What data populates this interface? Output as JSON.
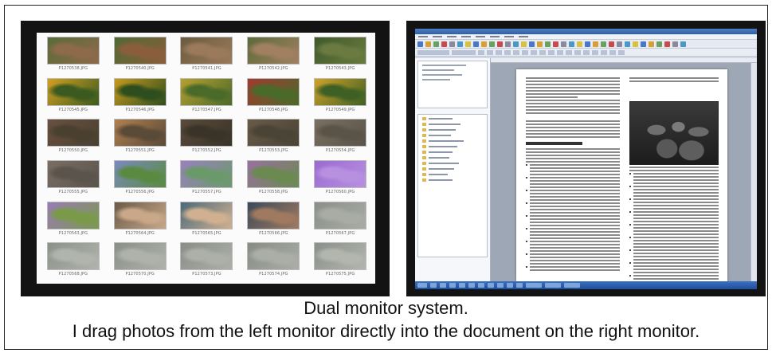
{
  "caption": {
    "line1": "Dual monitor system.",
    "line2": "I drag photos from the left monitor directly into the document on the right monitor."
  },
  "left_monitor": {
    "photos": [
      {
        "label": "P1270538.JPG",
        "palette": [
          "#5a6b3a",
          "#8c6a4a"
        ]
      },
      {
        "label": "P1270540.JPG",
        "palette": [
          "#4f6a35",
          "#8a5e3c"
        ]
      },
      {
        "label": "P1270541.JPG",
        "palette": [
          "#6a5a40",
          "#9a7a5a"
        ]
      },
      {
        "label": "P1270542.JPG",
        "palette": [
          "#5c6a3a",
          "#a08060"
        ]
      },
      {
        "label": "P1270543.JPG",
        "palette": [
          "#3e5a2a",
          "#6a7a40"
        ]
      },
      {
        "label": "P1270545.JPG",
        "palette": [
          "#d4a020",
          "#3a5a20"
        ]
      },
      {
        "label": "P1270546.JPG",
        "palette": [
          "#c89a1c",
          "#2e4e1e"
        ]
      },
      {
        "label": "P1270547.JPG",
        "palette": [
          "#b8a030",
          "#4a6a2a"
        ]
      },
      {
        "label": "P1270548.JPG",
        "palette": [
          "#a03a30",
          "#4a6a2a"
        ]
      },
      {
        "label": "P1270549.JPG",
        "palette": [
          "#d0a228",
          "#3e6024"
        ]
      },
      {
        "label": "P1270550.JPG",
        "palette": [
          "#6a5040",
          "#4a4030"
        ]
      },
      {
        "label": "P1270551.JPG",
        "palette": [
          "#b08050",
          "#5a4a38"
        ]
      },
      {
        "label": "P1270552.JPG",
        "palette": [
          "#5a4a3a",
          "#3a3428"
        ]
      },
      {
        "label": "P1270553.JPG",
        "palette": [
          "#6a5a48",
          "#4a4436"
        ]
      },
      {
        "label": "P1270554.JPG",
        "palette": [
          "#7a7060",
          "#5a5448"
        ]
      },
      {
        "label": "P1270555.JPG",
        "palette": [
          "#7a6e64",
          "#5a544c"
        ]
      },
      {
        "label": "P1270556.JPG",
        "palette": [
          "#7a8ac0",
          "#5a8a40"
        ]
      },
      {
        "label": "P1270557.JPG",
        "palette": [
          "#9a80c0",
          "#6a9a6a"
        ]
      },
      {
        "label": "P1270558.JPG",
        "palette": [
          "#9a70a0",
          "#6a8a50"
        ]
      },
      {
        "label": "P1270560.JPG",
        "palette": [
          "#9a6ad0",
          "#b890e0"
        ]
      },
      {
        "label": "P1270563.JPG",
        "palette": [
          "#9a7ab8",
          "#7a9a4a"
        ]
      },
      {
        "label": "P1270564.JPG",
        "palette": [
          "#6a5a48",
          "#c8a888"
        ]
      },
      {
        "label": "P1270565.JPG",
        "palette": [
          "#4a6a7a",
          "#d0b090"
        ]
      },
      {
        "label": "P1270566.JPG",
        "palette": [
          "#3a4a5a",
          "#a07a60"
        ]
      },
      {
        "label": "P1270567.JPG",
        "palette": [
          "#8a9088",
          "#a8aca4"
        ]
      },
      {
        "label": "P1270568.JPG",
        "palette": [
          "#8a9288",
          "#b0b4ac"
        ]
      },
      {
        "label": "P1270570.JPG",
        "palette": [
          "#8a9088",
          "#aeb2aa"
        ]
      },
      {
        "label": "P1270573.JPG",
        "palette": [
          "#888e86",
          "#acb0a8"
        ]
      },
      {
        "label": "P1270574.JPG",
        "palette": [
          "#868c84",
          "#aaaea6"
        ]
      },
      {
        "label": "P1270575.JPG",
        "palette": [
          "#8a908a",
          "#b2b6ae"
        ]
      }
    ]
  }
}
